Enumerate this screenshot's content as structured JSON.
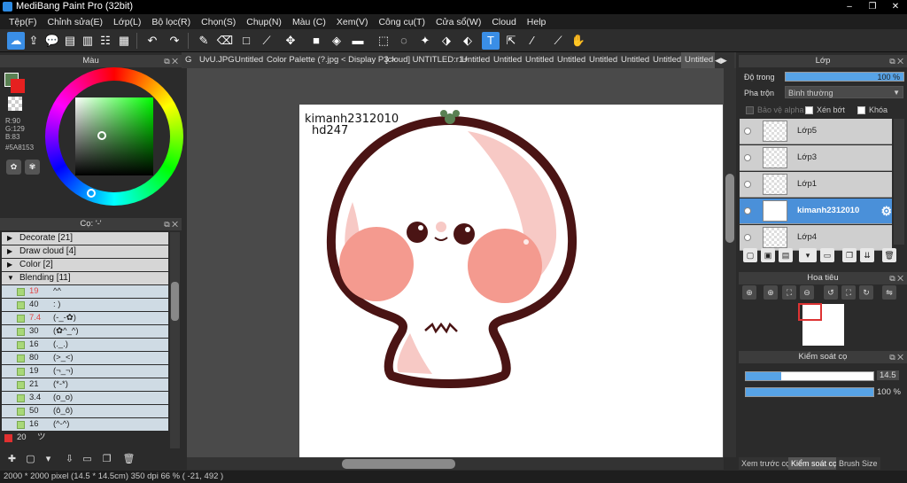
{
  "window": {
    "title": "MediBang Paint Pro (32bit)",
    "controls": [
      "–",
      "❐",
      "✕"
    ]
  },
  "menu": [
    "Tệp(F)",
    "Chỉnh sửa(E)",
    "Lớp(L)",
    "Bộ lọc(R)",
    "Chọn(S)",
    "Chụp(N)",
    "Màu (C)",
    "Xem(V)",
    "Công cụ(T)",
    "Cửa sổ(W)",
    "Cloud",
    "Help"
  ],
  "tabs": [
    "G",
    "UvU.JPG",
    "Untitled",
    "Color Palette (?.jpg < Display P3 >",
    "[cloud] UNTITLED:r1+",
    "Untitled",
    "Untitled",
    "Untitled",
    "Untitled",
    "Untitled",
    "Untitled",
    "Untitled",
    "Untitled"
  ],
  "color_panel": {
    "title": "Màu",
    "rgb": {
      "r": "R:90",
      "g": "G:129",
      "b": "B:83"
    },
    "hex": "#5A8153",
    "fg_color": "#5A8153",
    "bg_color": "#E62020"
  },
  "brush_panel": {
    "title": "Cọ: '-'",
    "categories": [
      {
        "label": "Decorate [21]",
        "expanded": false
      },
      {
        "label": "Draw cloud [4]",
        "expanded": false
      },
      {
        "label": "Color [2]",
        "expanded": false
      },
      {
        "label": "Blending [11]",
        "expanded": true
      }
    ],
    "brushes": [
      {
        "size": "19",
        "name": "^^",
        "red": true
      },
      {
        "size": "40",
        "name": ": )",
        "red": false
      },
      {
        "size": "7.4",
        "name": "(-_-✿)",
        "red": true
      },
      {
        "size": "30",
        "name": "(✿^_^)",
        "red": false
      },
      {
        "size": "16",
        "name": "(._.)",
        "red": false
      },
      {
        "size": "80",
        "name": "(>_<)",
        "red": false
      },
      {
        "size": "19",
        "name": "(¬_¬)",
        "red": false
      },
      {
        "size": "21",
        "name": "(*-*)",
        "red": false
      },
      {
        "size": "3.4",
        "name": "(o_o)",
        "red": false
      },
      {
        "size": "50",
        "name": "(ô_ô)",
        "red": false
      },
      {
        "size": "16",
        "name": "(^-^)",
        "red": false
      }
    ],
    "selected_brush": {
      "size": "20",
      "name": "ツ"
    }
  },
  "canvas": {
    "text_line1": "kimanh2312010",
    "text_line2": "hd247"
  },
  "layer_panel": {
    "title": "Lớp",
    "opacity_label": "Độ trong",
    "opacity_value": "100 %",
    "opacity_level": 1.0,
    "blend_label": "Pha trộn",
    "blend_value": "Bình thường",
    "protect_alpha": "Bảo vệ alpha",
    "clipping": "Xén bớt",
    "lock": "Khóa",
    "layers": [
      {
        "name": "Lớp5",
        "active": false
      },
      {
        "name": "Lớp3",
        "active": false
      },
      {
        "name": "Lớp1",
        "active": false
      },
      {
        "name": "kimanh2312010",
        "active": true
      },
      {
        "name": "Lớp4",
        "active": false
      }
    ]
  },
  "navigator": {
    "title": "Hoa tiêu"
  },
  "brush_control": {
    "title": "Kiểm soát cọ",
    "size_value": "14.5",
    "size_level": 0.28,
    "opacity_value": "100 %",
    "opacity_level": 1.0
  },
  "bottom_tabs": [
    "Xem trước cọ",
    "Kiểm soát cọ",
    "Brush Size"
  ],
  "status": "2000 * 2000 pixel   (14.5 * 14.5cm)   350 dpi   66 %   ( -21, 492 )"
}
